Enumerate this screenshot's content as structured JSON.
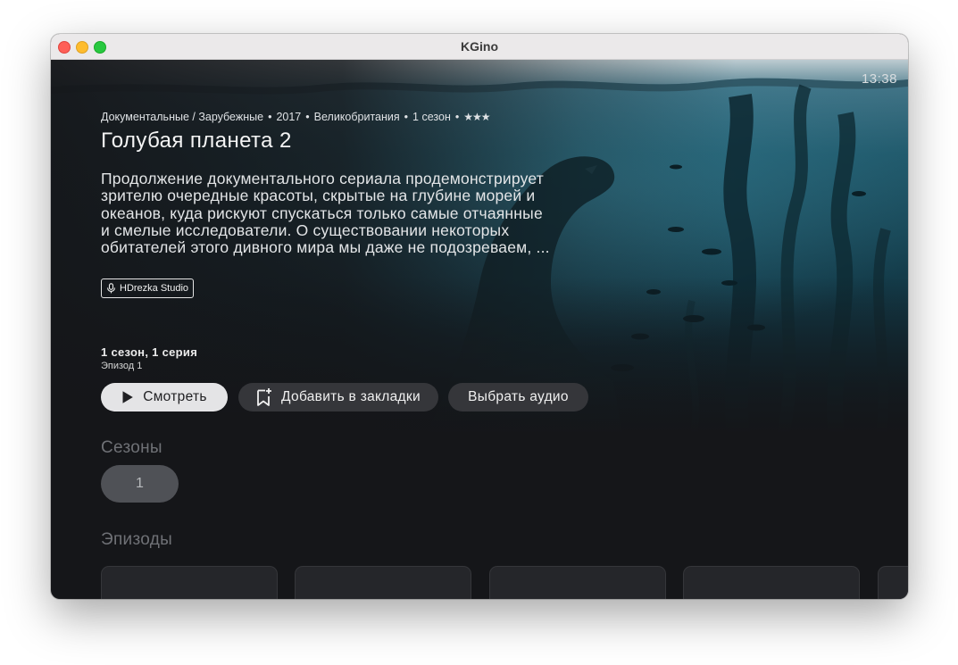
{
  "window": {
    "title": "KGino"
  },
  "clock": "13:38",
  "show": {
    "meta": {
      "genres": "Документальные / Зарубежные",
      "year": "2017",
      "country": "Великобритания",
      "seasons": "1 сезон",
      "separator": "•",
      "stars": "★★★"
    },
    "title": "Голубая планета 2",
    "description_lines": [
      "Продолжение документального сериала продемонстрирует",
      "зрителю очередные красоты, скрытые на глубине морей и",
      "океанов, куда рискуют спускаться только самые отчаянные",
      "и смелые исследователи. О существовании некоторых",
      "обитателей этого дивного мира мы даже не подозреваем, ..."
    ],
    "studio": {
      "label": "HDrezka Studio",
      "icon": "microphone-icon"
    }
  },
  "current_episode": {
    "title": "1 сезон, 1 серия",
    "subtitle": "Эпизод 1"
  },
  "actions": {
    "watch": {
      "label": "Смотреть",
      "icon": "play-icon"
    },
    "bookmark": {
      "label": "Добавить в закладки",
      "icon": "bookmark-add-icon"
    },
    "audio": {
      "label": "Выбрать аудио"
    }
  },
  "seasons": {
    "label": "Сезоны",
    "items": [
      "1"
    ]
  },
  "episodes": {
    "label": "Эпизоды",
    "card_count": 5
  },
  "colors": {
    "background": "#151619",
    "button_primary": "#e4e4e6",
    "button_secondary": "#35363a",
    "section_label": "#6f7176",
    "season_pill": "#4f5156"
  }
}
